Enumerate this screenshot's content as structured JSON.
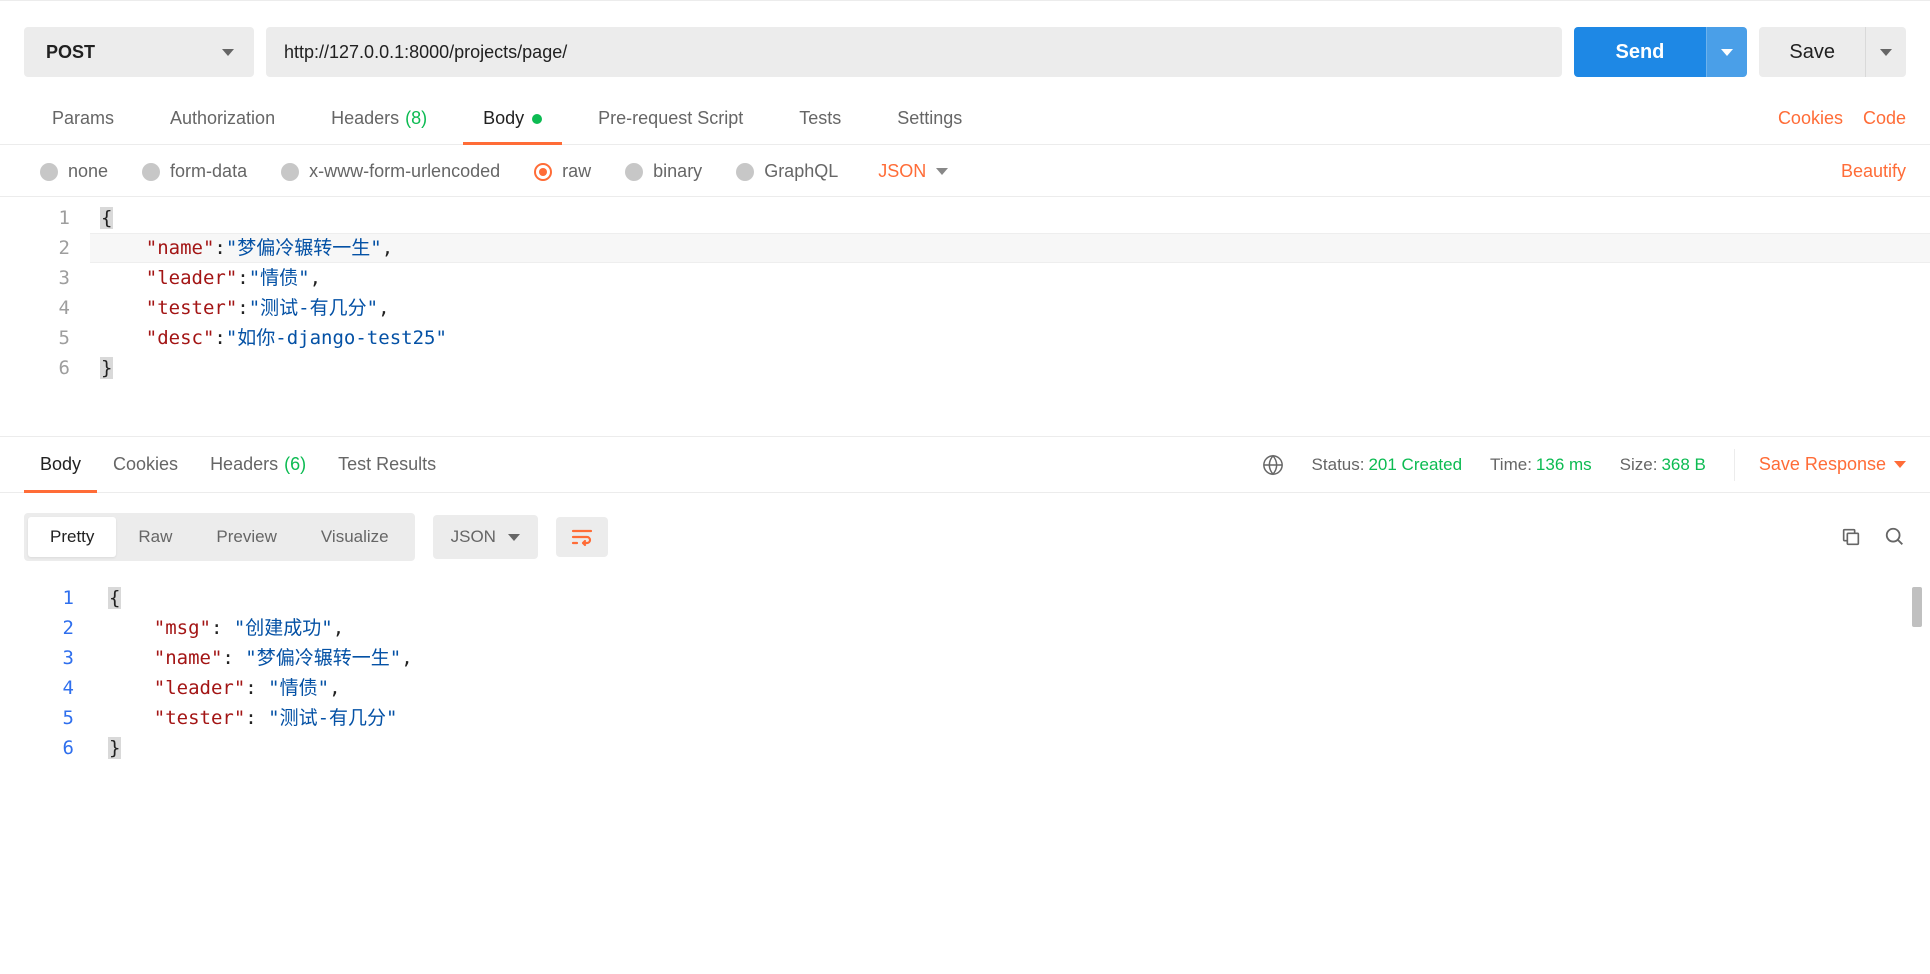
{
  "request": {
    "method": "POST",
    "url": "http://127.0.0.1:8000/projects/page/",
    "send_label": "Send",
    "save_label": "Save"
  },
  "request_tabs": {
    "params": "Params",
    "authorization": "Authorization",
    "headers": "Headers",
    "headers_count": "(8)",
    "body": "Body",
    "prerequest": "Pre-request Script",
    "tests": "Tests",
    "settings": "Settings",
    "cookies": "Cookies",
    "code": "Code"
  },
  "body_types": {
    "none": "none",
    "formdata": "form-data",
    "urlencoded": "x-www-form-urlencoded",
    "raw": "raw",
    "binary": "binary",
    "graphql": "GraphQL",
    "format": "JSON",
    "beautify": "Beautify"
  },
  "request_body": {
    "lines": [
      "1",
      "2",
      "3",
      "4",
      "5",
      "6"
    ],
    "l1_open": "{",
    "l2_key": "\"name\"",
    "l2_val": "\"梦偏冷辗转一生\"",
    "l3_key": "\"leader\"",
    "l3_val": "\"情债\"",
    "l4_key": "\"tester\"",
    "l4_val": "\"测试-有几分\"",
    "l5_key": "\"desc\"",
    "l5_val": "\"如你-django-test25\"",
    "l6_close": "}"
  },
  "response_tabs": {
    "body": "Body",
    "cookies": "Cookies",
    "headers": "Headers",
    "headers_count": "(6)",
    "test_results": "Test Results"
  },
  "response_meta": {
    "status_label": "Status:",
    "status_value": "201 Created",
    "time_label": "Time:",
    "time_value": "136 ms",
    "size_label": "Size:",
    "size_value": "368 B",
    "save_response": "Save Response"
  },
  "response_toolbar": {
    "pretty": "Pretty",
    "raw": "Raw",
    "preview": "Preview",
    "visualize": "Visualize",
    "format": "JSON"
  },
  "response_body": {
    "lines": [
      "1",
      "2",
      "3",
      "4",
      "5",
      "6"
    ],
    "l1_open": "{",
    "l2_key": "\"msg\"",
    "l2_val": "\"创建成功\"",
    "l3_key": "\"name\"",
    "l3_val": "\"梦偏冷辗转一生\"",
    "l4_key": "\"leader\"",
    "l4_val": "\"情债\"",
    "l5_key": "\"tester\"",
    "l5_val": "\"测试-有几分\"",
    "l6_close": "}"
  }
}
